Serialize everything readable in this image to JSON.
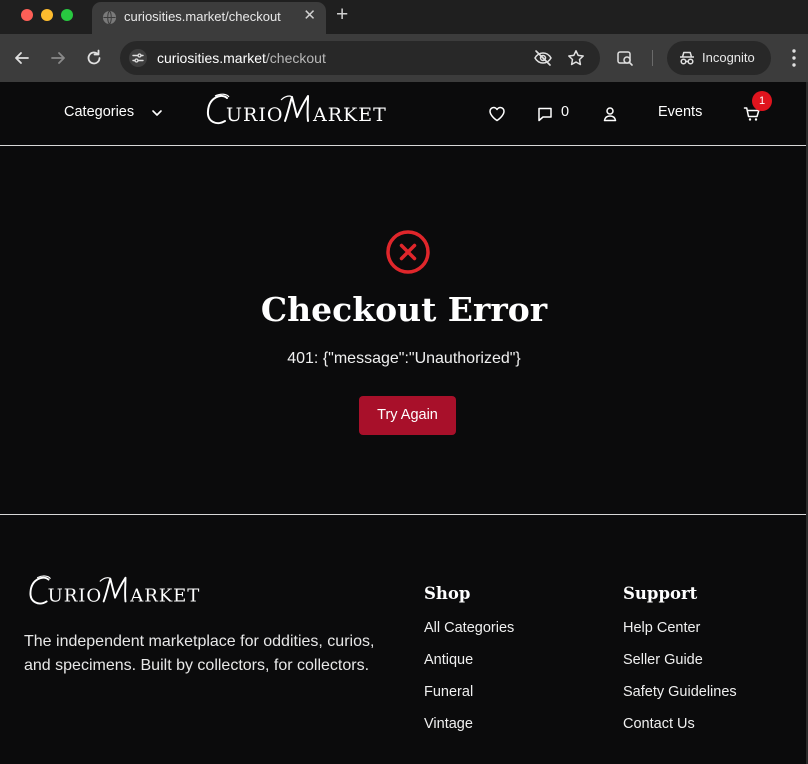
{
  "browser": {
    "tab_title": "curiosities.market/checkout",
    "tab_close": "✕",
    "new_tab": "+",
    "url_host": "curiosities.market",
    "url_path": "/checkout",
    "incognito_label": "Incognito"
  },
  "header": {
    "categories_label": "Categories",
    "logo_text": "Curio Market",
    "message_count": "0",
    "events_label": "Events",
    "cart_count": "1"
  },
  "error": {
    "title": "Checkout Error",
    "message": "401: {\"message\":\"Unauthorized\"}",
    "retry_label": "Try Again",
    "accent_color": "#e0262b"
  },
  "footer": {
    "logo_text": "Curio Market",
    "description": "The independent marketplace for oddities, curios, and specimens. Built by collectors, for collectors.",
    "shop": {
      "heading": "Shop",
      "links": [
        "All Categories",
        "Antique",
        "Funeral",
        "Vintage"
      ]
    },
    "support": {
      "heading": "Support",
      "links": [
        "Help Center",
        "Seller Guide",
        "Safety Guidelines",
        "Contact Us"
      ]
    }
  },
  "colors": {
    "background": "#0b0b0c",
    "button": "#a8102a",
    "badge": "#e0141e"
  }
}
